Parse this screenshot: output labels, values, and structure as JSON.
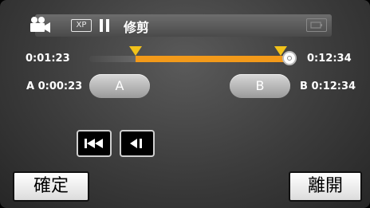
{
  "status_bar": {
    "mode_icon": "movie-camera-icon",
    "quality_badge": "XP",
    "playback_state_icon": "pause-icon",
    "title": "修剪",
    "battery_icon": "battery-icon"
  },
  "timeline": {
    "current_time": "0:01:23",
    "end_time": "0:12:34",
    "fill_color": "#f39a1a",
    "playhead_fraction": 1.0,
    "point_a_fraction": 0.24,
    "point_b_fraction": 0.97
  },
  "ab_controls": {
    "a_prefix": "A",
    "a_time": "0:00:23",
    "a_button_label": "A",
    "b_prefix": "B",
    "b_time": "0:12:34",
    "b_button_label": "B"
  },
  "playback_controls": {
    "skip_back_icon": "skip-to-start-icon",
    "frame_back_icon": "frame-back-icon"
  },
  "footer": {
    "confirm_label": "確定",
    "exit_label": "離開"
  }
}
